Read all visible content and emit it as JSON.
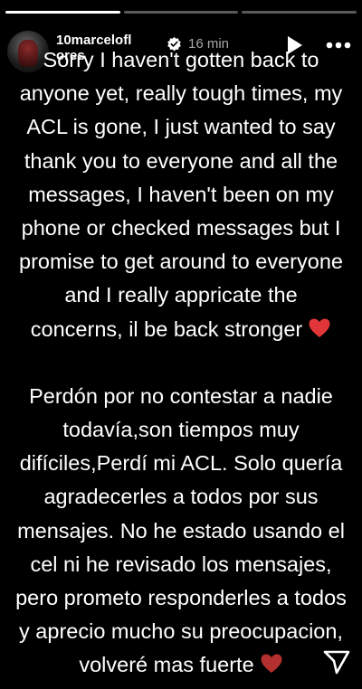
{
  "story": {
    "progress": [
      1,
      0,
      0
    ],
    "header": {
      "username": "10marcelofl ores",
      "timestamp": "16 min",
      "verified": true,
      "icons": {
        "verified": "verified-badge-icon",
        "play": "play-icon",
        "more": "more-options-icon"
      }
    },
    "text": {
      "english_lines": [
        "Sorry I haven't gotten back to",
        "anyone yet, really tough times, my",
        "ACL is gone, I just wanted to say",
        "thank you to everyone and all the",
        "messages, I haven't been on my",
        "phone or checked messages but I",
        "promise to get around to everyone",
        "and I really appricate the",
        "concerns, il be back stronger"
      ],
      "spanish_lines": [
        "Perdón por no contestar a nadie",
        "todavía,son tiempos muy",
        "difíciles,Perdí mi ACL. Solo quería",
        "agradecerles a todos por sus",
        "mensajes. No he estado usando el",
        "cel ni he revisado los mensajes,",
        "pero prometo responderles a todos",
        "y aprecio mucho su preocupacion,",
        "volveré mas fuerte"
      ],
      "heart_colors": {
        "red": "#e0363a",
        "dark_red": "#b4302f"
      }
    },
    "footer": {
      "share_icon": "share-paper-plane-icon"
    }
  }
}
